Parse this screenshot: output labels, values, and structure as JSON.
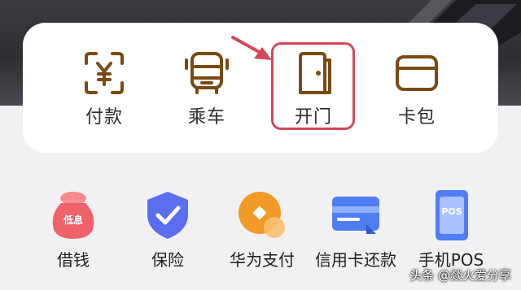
{
  "quick_actions": [
    {
      "label": "付款",
      "icon": "payment-yuan-icon"
    },
    {
      "label": "乘车",
      "icon": "bus-icon"
    },
    {
      "label": "开门",
      "icon": "door-icon"
    },
    {
      "label": "卡包",
      "icon": "wallet-icon"
    }
  ],
  "services": [
    {
      "label": "借钱",
      "icon": "loan-bag-icon",
      "badge": "低息"
    },
    {
      "label": "保险",
      "icon": "shield-check-icon"
    },
    {
      "label": "华为支付",
      "icon": "huawei-pay-coin-icon"
    },
    {
      "label": "信用卡还款",
      "icon": "credit-card-repay-icon"
    },
    {
      "label": "手机POS",
      "icon": "phone-pos-icon",
      "badge": "POS"
    }
  ],
  "watermark": "头条 @燚火爱分享",
  "colors": {
    "icon_brown": "#7a4a12",
    "highlight_red": "#d4495a",
    "shield_blue": "#5b6ef0",
    "coin_orange": "#f29a26",
    "card_blue": "#4f7df5",
    "loan_red": "#f0626a"
  }
}
